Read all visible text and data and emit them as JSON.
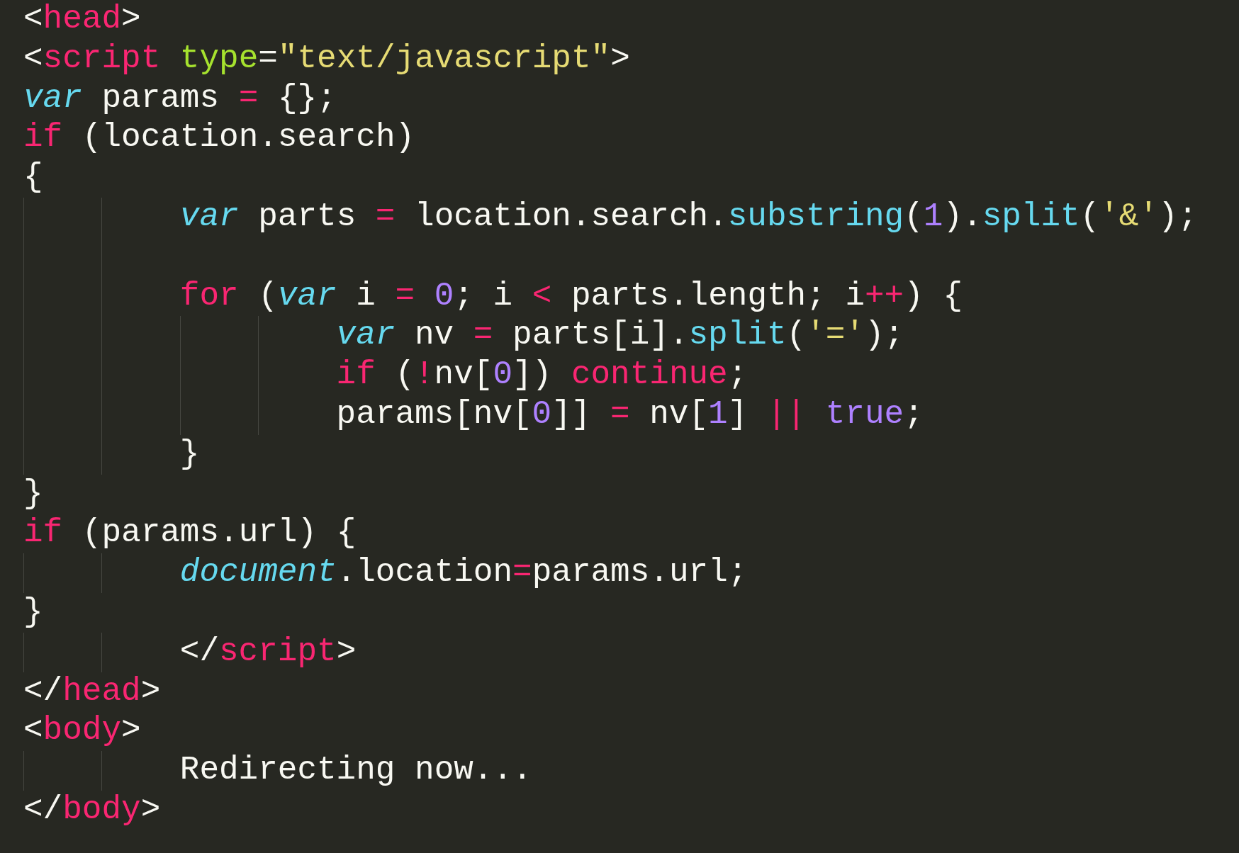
{
  "editor": {
    "lines": [
      {
        "kind": "code",
        "tokens": [
          {
            "text": "<",
            "kind": "plain"
          },
          {
            "text": "head",
            "kind": "tag"
          },
          {
            "text": ">",
            "kind": "plain"
          }
        ]
      },
      {
        "kind": "code",
        "tokens": [
          {
            "text": "<",
            "kind": "plain"
          },
          {
            "text": "script",
            "kind": "tag"
          },
          {
            "text": " type",
            "kind": "attr"
          },
          {
            "text": "=",
            "kind": "plain"
          },
          {
            "text": "\"text/javascript\"",
            "kind": "string"
          },
          {
            "text": ">",
            "kind": "plain"
          }
        ]
      },
      {
        "kind": "code",
        "tokens": [
          {
            "text": "var",
            "kind": "storage"
          },
          {
            "text": " params ",
            "kind": "plain"
          },
          {
            "text": "=",
            "kind": "operator"
          },
          {
            "text": " {};",
            "kind": "plain"
          }
        ]
      },
      {
        "kind": "code",
        "tokens": [
          {
            "text": "if",
            "kind": "keyword"
          },
          {
            "text": " (location.search)",
            "kind": "plain"
          }
        ]
      },
      {
        "kind": "code",
        "tokens": [
          {
            "text": "{",
            "kind": "plain"
          }
        ],
        "children": [
          {
            "kind": "code",
            "tokens": [
              {
                "text": "var",
                "kind": "storage"
              },
              {
                "text": " parts ",
                "kind": "plain"
              },
              {
                "text": "=",
                "kind": "operator"
              },
              {
                "text": " location.search.",
                "kind": "plain"
              },
              {
                "text": "substring",
                "kind": "support"
              },
              {
                "text": "(",
                "kind": "plain"
              },
              {
                "text": "1",
                "kind": "number"
              },
              {
                "text": ").",
                "kind": "plain"
              },
              {
                "text": "split",
                "kind": "support"
              },
              {
                "text": "(",
                "kind": "plain"
              },
              {
                "text": "'&'",
                "kind": "string"
              },
              {
                "text": ");",
                "kind": "plain"
              }
            ]
          },
          {
            "kind": "blank"
          },
          {
            "kind": "code",
            "tokens": [
              {
                "text": "for",
                "kind": "keyword"
              },
              {
                "text": " (",
                "kind": "plain"
              },
              {
                "text": "var",
                "kind": "storage"
              },
              {
                "text": " i ",
                "kind": "plain"
              },
              {
                "text": "= ",
                "kind": "operator"
              },
              {
                "text": "0",
                "kind": "number"
              },
              {
                "text": "; i ",
                "kind": "plain"
              },
              {
                "text": "<",
                "kind": "operator"
              },
              {
                "text": " parts.length; i",
                "kind": "plain"
              },
              {
                "text": "++",
                "kind": "operator"
              },
              {
                "text": ") {",
                "kind": "plain"
              }
            ],
            "children": [
              {
                "kind": "code",
                "tokens": [
                  {
                    "text": "var",
                    "kind": "storage"
                  },
                  {
                    "text": " nv ",
                    "kind": "plain"
                  },
                  {
                    "text": "=",
                    "kind": "operator"
                  },
                  {
                    "text": " parts[i].",
                    "kind": "plain"
                  },
                  {
                    "text": "split",
                    "kind": "support"
                  },
                  {
                    "text": "(",
                    "kind": "plain"
                  },
                  {
                    "text": "'='",
                    "kind": "string"
                  },
                  {
                    "text": ");",
                    "kind": "plain"
                  }
                ]
              },
              {
                "kind": "code",
                "tokens": [
                  {
                    "text": "if",
                    "kind": "keyword"
                  },
                  {
                    "text": " (",
                    "kind": "plain"
                  },
                  {
                    "text": "!",
                    "kind": "operator"
                  },
                  {
                    "text": "nv[",
                    "kind": "plain"
                  },
                  {
                    "text": "0",
                    "kind": "number"
                  },
                  {
                    "text": "]) ",
                    "kind": "plain"
                  },
                  {
                    "text": "continue",
                    "kind": "keyword"
                  },
                  {
                    "text": ";",
                    "kind": "plain"
                  }
                ]
              },
              {
                "kind": "code",
                "tokens": [
                  {
                    "text": "params[nv[",
                    "kind": "plain"
                  },
                  {
                    "text": "0",
                    "kind": "number"
                  },
                  {
                    "text": "]] ",
                    "kind": "plain"
                  },
                  {
                    "text": "=",
                    "kind": "operator"
                  },
                  {
                    "text": " nv[",
                    "kind": "plain"
                  },
                  {
                    "text": "1",
                    "kind": "number"
                  },
                  {
                    "text": "] ",
                    "kind": "plain"
                  },
                  {
                    "text": "|| ",
                    "kind": "operator"
                  },
                  {
                    "text": "true",
                    "kind": "number"
                  },
                  {
                    "text": ";",
                    "kind": "plain"
                  }
                ]
              }
            ]
          },
          {
            "kind": "code",
            "tokens": [
              {
                "text": "}",
                "kind": "plain"
              }
            ]
          }
        ]
      },
      {
        "kind": "code",
        "tokens": [
          {
            "text": "}",
            "kind": "plain"
          }
        ]
      },
      {
        "kind": "code",
        "tokens": [
          {
            "text": "if",
            "kind": "keyword"
          },
          {
            "text": " (params.url) {",
            "kind": "plain"
          }
        ],
        "children": [
          {
            "kind": "code",
            "tokens": [
              {
                "text": "document",
                "kind": "storage"
              },
              {
                "text": ".location",
                "kind": "plain"
              },
              {
                "text": "=",
                "kind": "operator"
              },
              {
                "text": "params.url;",
                "kind": "plain"
              }
            ]
          }
        ]
      },
      {
        "kind": "code",
        "tokens": [
          {
            "text": "}",
            "kind": "plain"
          }
        ],
        "children": [
          {
            "kind": "code",
            "tokens": [
              {
                "text": "</",
                "kind": "plain"
              },
              {
                "text": "script",
                "kind": "tag"
              },
              {
                "text": ">",
                "kind": "plain"
              }
            ]
          }
        ]
      },
      {
        "kind": "code",
        "tokens": [
          {
            "text": "</",
            "kind": "plain"
          },
          {
            "text": "head",
            "kind": "tag"
          },
          {
            "text": ">",
            "kind": "plain"
          }
        ]
      },
      {
        "kind": "code",
        "tokens": [
          {
            "text": "<",
            "kind": "plain"
          },
          {
            "text": "body",
            "kind": "tag"
          },
          {
            "text": ">",
            "kind": "plain"
          }
        ],
        "children": [
          {
            "kind": "code",
            "tokens": [
              {
                "text": "Redirecting now...",
                "kind": "plain"
              }
            ]
          }
        ]
      },
      {
        "kind": "code",
        "tokens": [
          {
            "text": "</",
            "kind": "plain"
          },
          {
            "text": "body",
            "kind": "tag"
          },
          {
            "text": ">",
            "kind": "plain"
          }
        ]
      }
    ]
  }
}
